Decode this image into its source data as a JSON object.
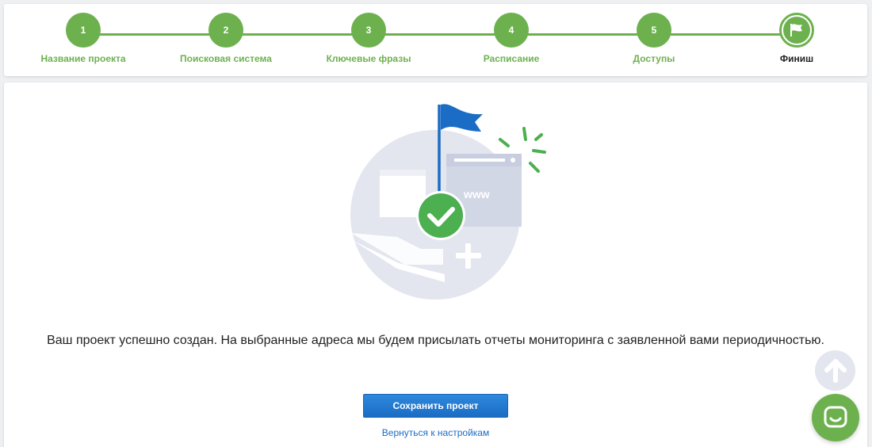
{
  "stepper": {
    "steps": [
      {
        "number": "1",
        "label": "Название проекта"
      },
      {
        "number": "2",
        "label": "Поисковая система"
      },
      {
        "number": "3",
        "label": "Ключевые фразы"
      },
      {
        "number": "4",
        "label": "Расписание"
      },
      {
        "number": "5",
        "label": "Доступы"
      },
      {
        "number": "",
        "label": "Финиш",
        "active": true,
        "icon": "flag-icon"
      }
    ]
  },
  "main": {
    "illustration_text": "www",
    "message": "Ваш проект успешно создан. На выбранные адреса мы будем присылать отчеты мониторинга с заявленной вами периодичностью.",
    "save_button": "Сохранить проект",
    "back_link": "Вернуться к настройкам"
  },
  "floating": {
    "scroll_top_icon": "arrow-up-icon",
    "chat_icon": "chat-icon"
  },
  "colors": {
    "accent_green": "#6db14f",
    "primary_blue": "#1a6cc4",
    "illustration_gray": "#e3e6ef"
  }
}
